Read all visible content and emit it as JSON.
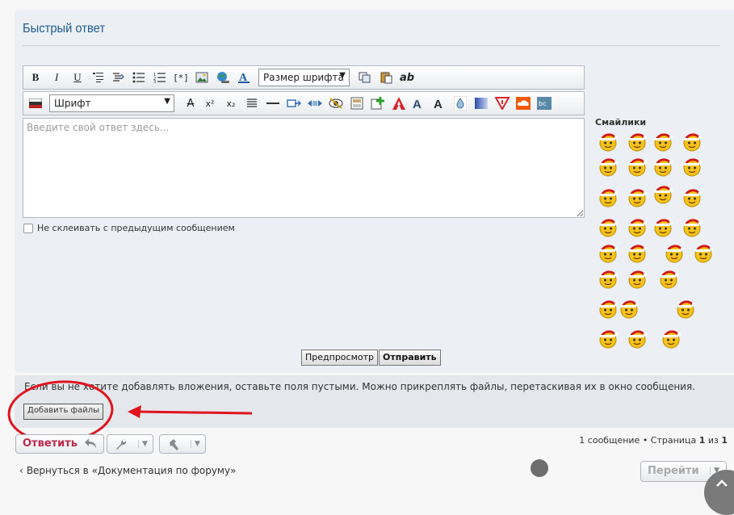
{
  "form": {
    "title": "Быстрый ответ",
    "font_size_select": "Размер шрифта",
    "font_select": "Шрифт",
    "textarea_placeholder": "Введите свой ответ здесь...",
    "no_merge_label": "Не склеивать с предыдущим сообщением",
    "bold_label": "B",
    "italic_label": "I",
    "underline_label": "U",
    "ab_label": "ab",
    "smilies_title": "Смайлики",
    "preview_button": "Предпросмотр",
    "submit_button": "Отправить"
  },
  "attachments": {
    "notice": "Если вы не хотите добавлять вложения, оставьте поля пустыми. Можно прикреплять файлы, перетаскивая их в окно сообщения.",
    "add_files_button": "Добавить файлы"
  },
  "footer": {
    "reply_button": "Ответить",
    "pagination_text": "1 сообщение • Страница ",
    "page_current": "1",
    "page_of": " из ",
    "page_total": "1",
    "back_link": "Вернуться в «Документация по форуму»",
    "goto_button": "Перейти"
  },
  "colors": {
    "title": "#1d5a94",
    "reply_text": "#bc2a4d",
    "annotation_red": "#e0141e",
    "panel_bg": "#eceff3"
  },
  "icons": [
    "bold-icon",
    "italic-icon",
    "underline-icon",
    "quote-icon",
    "code-icon",
    "list-icon",
    "ordered-list-icon",
    "list-item-icon",
    "image-icon",
    "url-icon",
    "font-color-icon",
    "flag-icon",
    "strike-icon",
    "superscript-icon",
    "subscript-icon",
    "justify-icon",
    "hr-icon",
    "spoiler-icon",
    "hide-icon",
    "eye-icon",
    "offtop-icon",
    "add-icon",
    "adobe-icon",
    "font-a-icon",
    "font-a2-icon",
    "drop-icon",
    "gradient-icon",
    "warning-icon",
    "soundcloud-icon",
    "bc-icon"
  ]
}
